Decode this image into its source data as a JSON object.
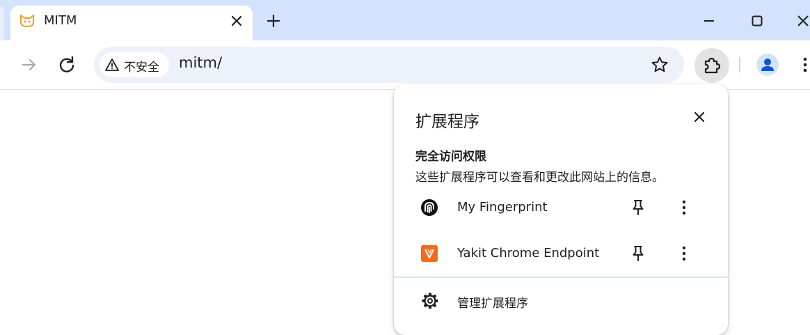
{
  "colors": {
    "tabstrip_bg": "#d3e3fd",
    "omnibox_bg": "#edf2fa",
    "accent": "#0b57d0",
    "yakit_orange": "#f26b1d"
  },
  "tab": {
    "title": "MITM",
    "favicon": "cat-face-icon"
  },
  "toolbar": {
    "security_chip": "不安全",
    "url": "mitm/"
  },
  "extensions_popup": {
    "title": "扩展程序",
    "section_title": "完全访问权限",
    "section_description": "这些扩展程序可以查看和更改此网站上的信息。",
    "items": [
      {
        "name": "My Fingerprint",
        "icon": "fingerprint-icon"
      },
      {
        "name": "Yakit Chrome Endpoint",
        "icon": "yakit-logo-icon"
      }
    ],
    "manage_label": "管理扩展程序"
  }
}
